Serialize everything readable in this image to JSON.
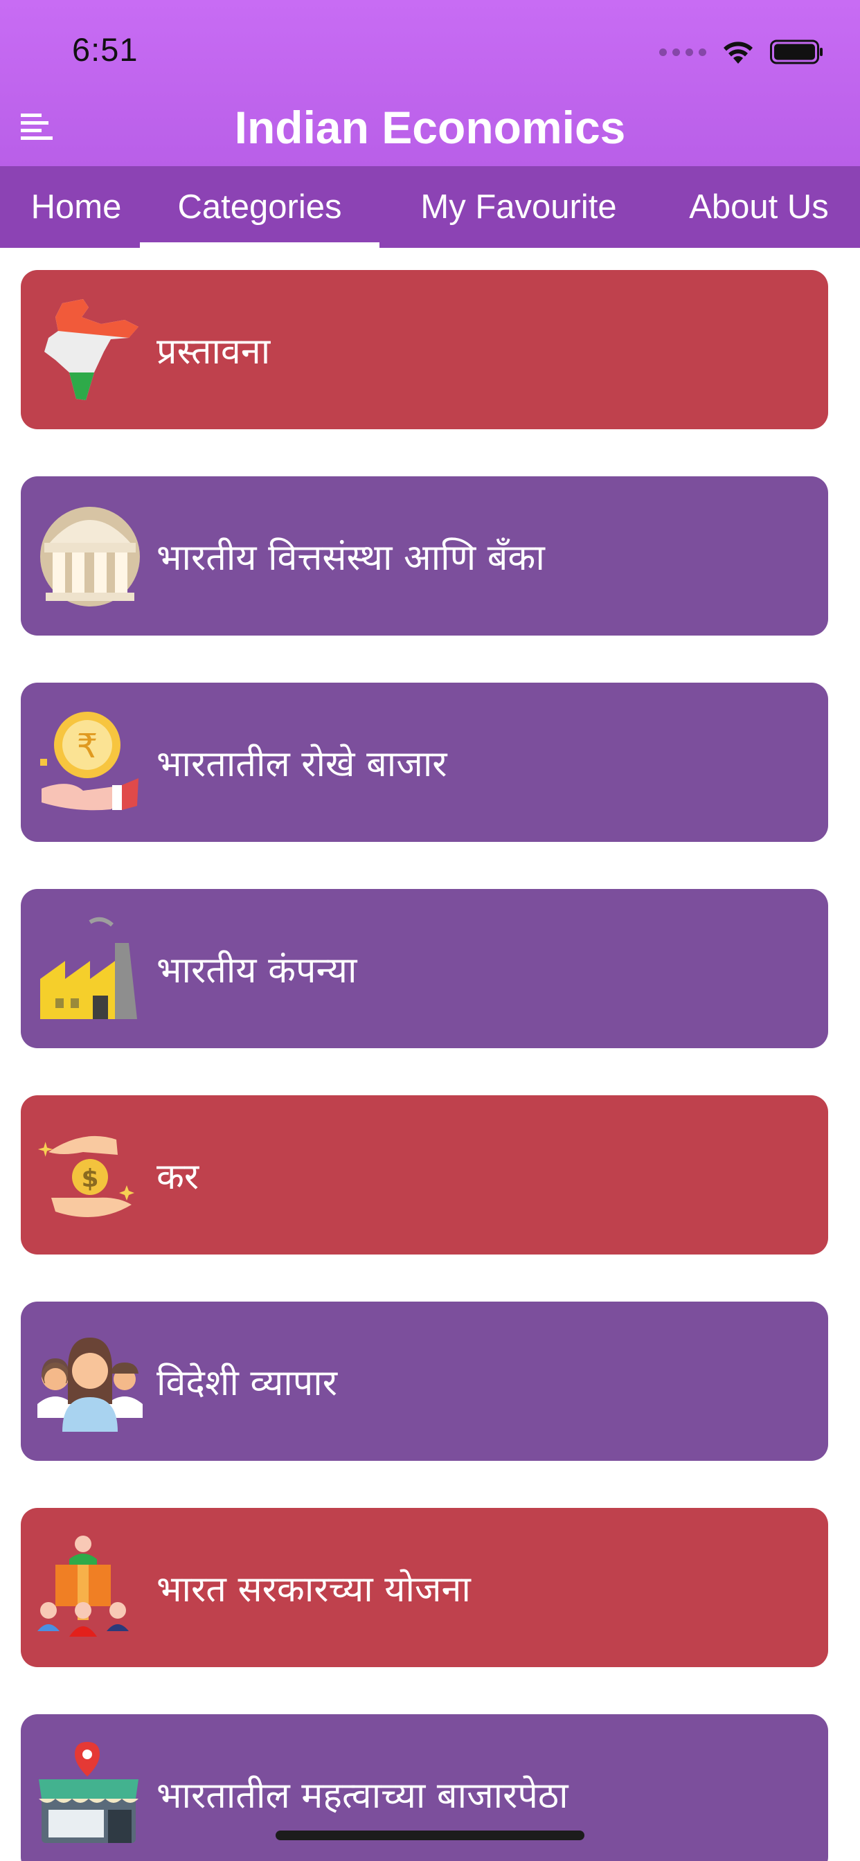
{
  "status_bar": {
    "time": "6:51"
  },
  "header": {
    "title": "Indian Economics"
  },
  "tabs": [
    {
      "label": "Home"
    },
    {
      "label": "Categories"
    },
    {
      "label": "My Favourite"
    },
    {
      "label": "About Us"
    }
  ],
  "active_tab": "Categories",
  "colors": {
    "header": "#c86cf4",
    "tabbar": "#8c43b4",
    "card_red": "#bf414d",
    "card_purple": "#7c4f9c"
  },
  "categories": [
    {
      "label": "प्रस्तावना",
      "color": "#bf414d",
      "icon": "india-map-icon"
    },
    {
      "label": "भारतीय वित्तसंस्था आणि बँका",
      "color": "#7c4f9c",
      "icon": "bank-building-icon"
    },
    {
      "label": "भारतातील रोखे बाजार",
      "color": "#7c4f9c",
      "icon": "rupee-coin-hand-icon"
    },
    {
      "label": "भारतीय कंपन्या",
      "color": "#7c4f9c",
      "icon": "factory-icon"
    },
    {
      "label": "कर",
      "color": "#bf414d",
      "icon": "dollar-hands-icon"
    },
    {
      "label": "विदेशी व्यापार",
      "color": "#7c4f9c",
      "icon": "people-group-icon"
    },
    {
      "label": "भारत सरकारच्या योजना",
      "color": "#bf414d",
      "icon": "government-leader-icon"
    },
    {
      "label": "भारतातील महत्वाच्या बाजारपेठा",
      "color": "#7c4f9c",
      "icon": "market-store-icon"
    }
  ]
}
